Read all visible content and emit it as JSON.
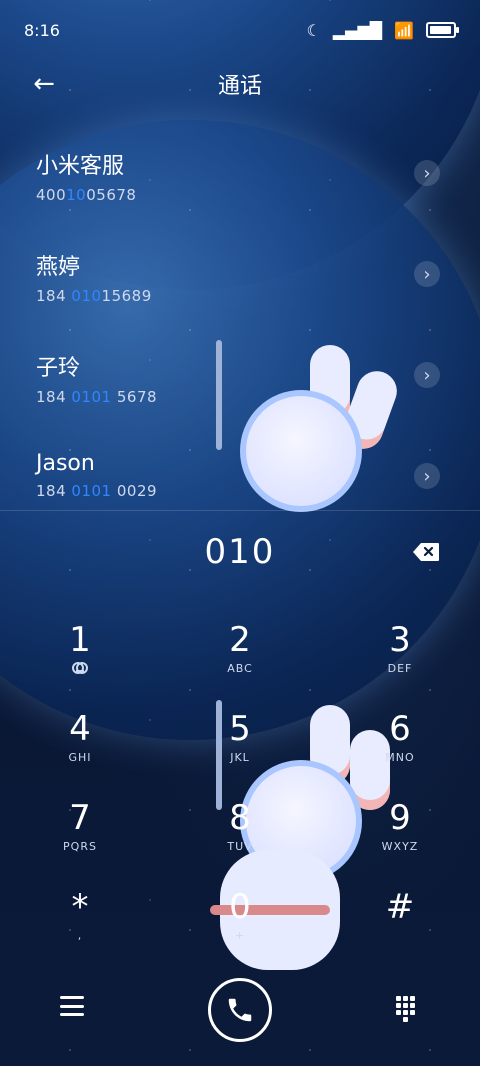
{
  "status_bar": {
    "time": "8:16",
    "icons": [
      "moon-icon",
      "signal-icon",
      "wifi-icon",
      "battery-icon"
    ],
    "battery_level": 0.95
  },
  "header": {
    "title": "通话",
    "back_icon": "back-arrow-icon"
  },
  "contacts": [
    {
      "name": "小米客服",
      "number_prefix": "400",
      "number_highlight": "10",
      "number_suffix": "05678"
    },
    {
      "name": "燕婷",
      "number_prefix": "184 ",
      "number_highlight": "010",
      "number_suffix": "15689"
    },
    {
      "name": "子玲",
      "number_prefix": "184 ",
      "number_highlight": "0101",
      "number_suffix": " 5678"
    },
    {
      "name": "Jason",
      "number_prefix": "184 ",
      "number_highlight": "0101",
      "number_suffix": " 0029"
    }
  ],
  "dialer": {
    "input_value": "010",
    "backspace_icon": "backspace-icon"
  },
  "keypad": [
    {
      "digit": "1",
      "letters": ""
    },
    {
      "digit": "2",
      "letters": "ABC"
    },
    {
      "digit": "3",
      "letters": "DEF"
    },
    {
      "digit": "4",
      "letters": "GHI"
    },
    {
      "digit": "5",
      "letters": "JKL"
    },
    {
      "digit": "6",
      "letters": "MNO"
    },
    {
      "digit": "7",
      "letters": "PQRS"
    },
    {
      "digit": "8",
      "letters": "TUV"
    },
    {
      "digit": "9",
      "letters": "WXYZ"
    },
    {
      "digit": "*",
      "letters": ","
    },
    {
      "digit": "0",
      "letters": "+"
    },
    {
      "digit": "#",
      "letters": ""
    }
  ],
  "bottom_bar": {
    "menu_icon": "menu-icon",
    "call_icon": "phone-icon",
    "keypad_icon": "dialpad-icon"
  },
  "colors": {
    "accent": "#2f86ff",
    "background": "#06142c"
  }
}
